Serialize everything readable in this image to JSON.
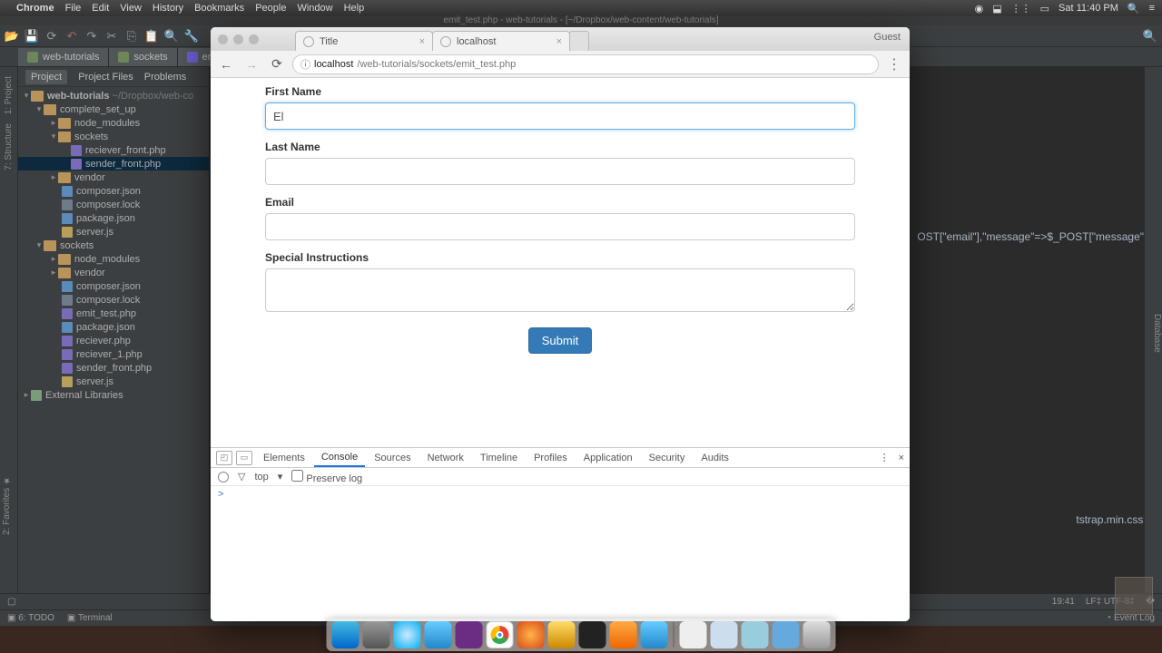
{
  "menubar": {
    "app": "Chrome",
    "items": [
      "File",
      "Edit",
      "View",
      "History",
      "Bookmarks",
      "People",
      "Window",
      "Help"
    ],
    "clock": "Sat 11:40 PM"
  },
  "ide": {
    "title": "emit_test.php - web-tutorials - [~/Dropbox/web-content/web-tutorials]",
    "tabs": [
      "web-tutorials",
      "sockets",
      "emit_test.php"
    ],
    "proj_tabs": [
      "Project",
      "Project Files",
      "Problems"
    ],
    "tree": {
      "root": "web-tutorials",
      "root_path": "~/Dropbox/web-co",
      "n1": "complete_set_up",
      "n1a": "node_modules",
      "n1b": "sockets",
      "n1b1": "reciever_front.php",
      "n1b2": "sender_front.php",
      "n1c": "vendor",
      "n1d": "composer.json",
      "n1e": "composer.lock",
      "n1f": "package.json",
      "n1g": "server.js",
      "n2": "sockets",
      "n2a": "node_modules",
      "n2b": "vendor",
      "n2c": "composer.json",
      "n2d": "composer.lock",
      "n2e": "emit_test.php",
      "n2f": "package.json",
      "n2g": "reciever.php",
      "n2h": "reciever_1.php",
      "n2i": "sender_front.php",
      "n2j": "server.js",
      "ext": "External Libraries"
    },
    "code_frag1": "OST[\"email\"],\"message\"=>$_POST[\"message\"]]);",
    "code_frag2": "tstrap.min.css\"/>",
    "bottombar": {
      "todo": "6: TODO",
      "term": "Terminal",
      "eventlog": "Event Log"
    },
    "status": {
      "pos": "19:41",
      "enc": "LF‡ UTF-8‡",
      "ctx": "�"
    }
  },
  "chrome": {
    "tabs": [
      {
        "label": "Title"
      },
      {
        "label": "localhost"
      }
    ],
    "guest": "Guest",
    "url_host": "localhost",
    "url_path": "/web-tutorials/sockets/emit_test.php",
    "form": {
      "fn_label": "First Name",
      "fn_value": "El",
      "ln_label": "Last Name",
      "em_label": "Email",
      "si_label": "Special Instructions",
      "submit": "Submit"
    },
    "devtools": {
      "tabs": [
        "Elements",
        "Console",
        "Sources",
        "Network",
        "Timeline",
        "Profiles",
        "Application",
        "Security",
        "Audits"
      ],
      "active": "Console",
      "ctx": "top",
      "preserve": "Preserve log",
      "prompt": ">"
    }
  }
}
